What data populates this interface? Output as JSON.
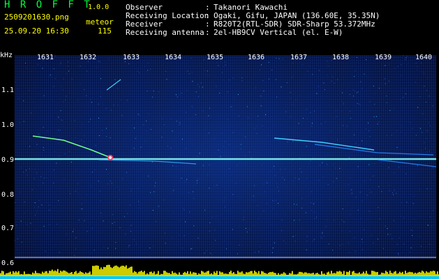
{
  "header": {
    "app_title": "H R O F F T",
    "app_version": "1.0.0",
    "file_name": "2509201630.png",
    "date_time": "25.09.20 16:30",
    "count_label": "meteor",
    "count_value": "115"
  },
  "info": {
    "separator": ":",
    "rows": [
      {
        "label": "Observer",
        "value": "Takanori Kawachi"
      },
      {
        "label": "Receiving Location",
        "value": "Ogaki, Gifu, JAPAN (136.60E, 35.35N)"
      },
      {
        "label": "Receiver",
        "value": "R820T2(RTL-SDR) SDR-Sharp 53.372MHz"
      },
      {
        "label": "Receiving antenna",
        "value": "2el-HB9CV Vertical (el. E-W)"
      }
    ]
  },
  "axes": {
    "freq_unit": "kHz",
    "time_ticks": [
      "1631",
      "1632",
      "1633",
      "1634",
      "1635",
      "1636",
      "1637",
      "1638",
      "1639",
      "1640"
    ],
    "freq_ticks": [
      "1.1",
      "1.0",
      "0.9",
      "0.8",
      "0.7",
      "0.6"
    ]
  },
  "colors": {
    "title": "#00ff3c",
    "header_text": "#ffff00",
    "carrier": "#ffffff",
    "spectrum_fill": "#ffff00",
    "spectrum_base": "#00c8ff"
  }
}
